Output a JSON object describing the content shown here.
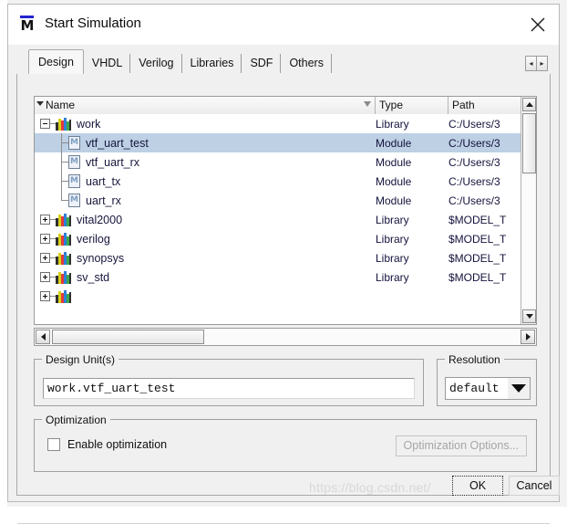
{
  "window": {
    "title": "Start Simulation",
    "app_icon": "modelsim-m-icon",
    "icon_letter": "M",
    "close_label": "✕"
  },
  "tabs": {
    "selected": "Design",
    "items": [
      {
        "label": "Design",
        "selected": true
      },
      {
        "label": "VHDL",
        "selected": false
      },
      {
        "label": "Verilog",
        "selected": false
      },
      {
        "label": "Libraries",
        "selected": false
      },
      {
        "label": "SDF",
        "selected": false
      },
      {
        "label": "Others",
        "selected": false
      }
    ],
    "scroll_left": "◂",
    "scroll_right": "▸"
  },
  "tree": {
    "columns": [
      {
        "key": "name",
        "label": "Name"
      },
      {
        "key": "type",
        "label": "Type"
      },
      {
        "key": "path",
        "label": "Path"
      }
    ],
    "rows": [
      {
        "name": "work",
        "type": "Library",
        "path": "C:/Users/3",
        "icon": "library-icon",
        "depth": 0,
        "expander": "minus",
        "selected": false
      },
      {
        "name": "vtf_uart_test",
        "type": "Module",
        "path": "C:/Users/3",
        "icon": "module-icon",
        "depth": 1,
        "expander": "none",
        "selected": true
      },
      {
        "name": "vtf_uart_rx",
        "type": "Module",
        "path": "C:/Users/3",
        "icon": "module-icon",
        "depth": 1,
        "expander": "none",
        "selected": false
      },
      {
        "name": "uart_tx",
        "type": "Module",
        "path": "C:/Users/3",
        "icon": "module-icon",
        "depth": 1,
        "expander": "none",
        "selected": false
      },
      {
        "name": "uart_rx",
        "type": "Module",
        "path": "C:/Users/3",
        "icon": "module-icon",
        "depth": 1,
        "expander": "none",
        "selected": false
      },
      {
        "name": "vital2000",
        "type": "Library",
        "path": "$MODEL_T",
        "icon": "library-icon",
        "depth": 0,
        "expander": "plus",
        "selected": false
      },
      {
        "name": "verilog",
        "type": "Library",
        "path": "$MODEL_T",
        "icon": "library-icon",
        "depth": 0,
        "expander": "plus",
        "selected": false
      },
      {
        "name": "synopsys",
        "type": "Library",
        "path": "$MODEL_T",
        "icon": "library-icon",
        "depth": 0,
        "expander": "plus",
        "selected": false
      },
      {
        "name": "sv_std",
        "type": "Library",
        "path": "$MODEL_T",
        "icon": "library-icon",
        "depth": 0,
        "expander": "plus",
        "selected": false
      },
      {
        "name": "",
        "type": "",
        "path": "",
        "icon": "library-icon",
        "depth": 0,
        "expander": "plus",
        "selected": false
      }
    ],
    "vscroll": {
      "up": "▲",
      "down": "▼"
    },
    "hscroll": {
      "left": "◀",
      "right": "▶"
    }
  },
  "design_units": {
    "group_title": "Design Unit(s)",
    "value": "work.vtf_uart_test",
    "placeholder": ""
  },
  "resolution": {
    "group_title": "Resolution",
    "value": "default",
    "options": [
      "default"
    ]
  },
  "optimization": {
    "group_title": "Optimization",
    "checkbox_label": "Enable optimization",
    "checked": false,
    "options_button": "Optimization Options...",
    "options_button_enabled": false
  },
  "footer": {
    "ok_label": "OK",
    "cancel_label": "Cancel"
  },
  "watermark": {
    "text": "https://blog.csdn.net/"
  },
  "colors": {
    "selection": "#bdd0e4",
    "dialog_bg": "#f0f0f0",
    "accent_blue": "#2323d0",
    "text": "#111111",
    "disabled_text": "#a6a6a6"
  }
}
